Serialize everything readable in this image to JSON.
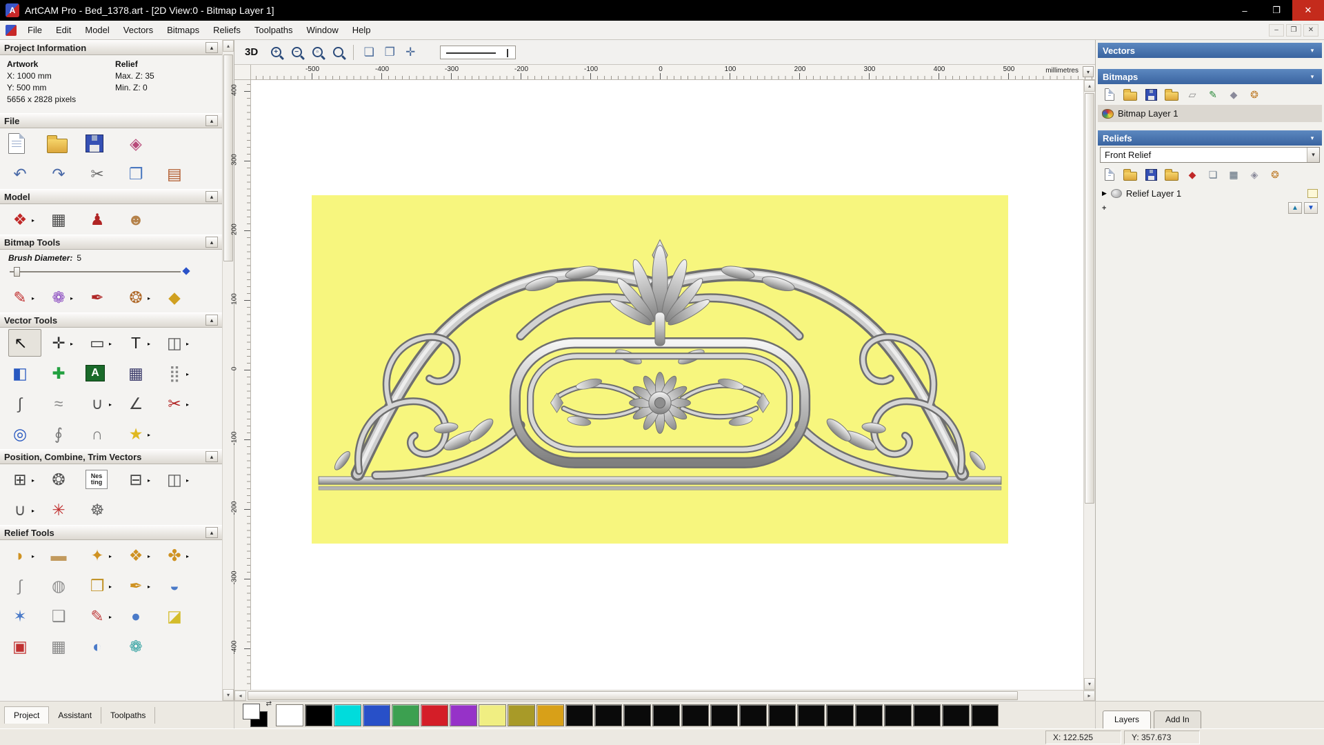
{
  "window": {
    "title": "ArtCAM Pro - Bed_1378.art - [2D View:0 - Bitmap Layer 1]"
  },
  "menu": {
    "items": [
      "File",
      "Edit",
      "Model",
      "Vectors",
      "Bitmaps",
      "Reliefs",
      "Toolpaths",
      "Window",
      "Help"
    ]
  },
  "left_panel": {
    "project_information": {
      "title": "Project Information",
      "artwork_label": "Artwork",
      "relief_label": "Relief",
      "x": "X: 1000 mm",
      "y": "Y: 500 mm",
      "pixels": "5656 x 2828 pixels",
      "max_z": "Max. Z: 35",
      "min_z": "Min. Z: 0"
    },
    "sections": {
      "file": "File",
      "model": "Model",
      "bitmap_tools": "Bitmap Tools",
      "vector_tools": "Vector Tools",
      "position_combine": "Position, Combine, Trim Vectors",
      "relief_tools": "Relief Tools"
    },
    "brush": {
      "label": "Brush Diameter:",
      "value": "5"
    },
    "tabs": [
      "Project",
      "Assistant",
      "Toolpaths"
    ],
    "icons": {
      "file_row1": [
        {
          "name": "new-model",
          "style": "ic-page"
        },
        {
          "name": "open-model",
          "style": "ic-folder"
        },
        {
          "name": "save-model",
          "style": "ic-disk"
        },
        {
          "name": "import-model",
          "glyph": "◈",
          "color": "#b84a7a"
        }
      ],
      "file_row2": [
        {
          "name": "undo",
          "glyph": "↶",
          "color": "#4a6aa8"
        },
        {
          "name": "redo",
          "glyph": "↷",
          "color": "#4a6aa8"
        },
        {
          "name": "cut",
          "glyph": "✂",
          "color": "#6a6a6a"
        },
        {
          "name": "copy",
          "glyph": "❐",
          "color": "#4a78c0"
        },
        {
          "name": "paste",
          "glyph": "▤",
          "color": "#b0582a"
        }
      ],
      "model_row": [
        {
          "name": "set-model-size",
          "glyph": "❖",
          "color": "#c02828",
          "flyout": true
        },
        {
          "name": "add-draft",
          "glyph": "▦",
          "color": "#4a4a4a"
        },
        {
          "name": "import-clipart",
          "glyph": "♟",
          "color": "#b02424"
        },
        {
          "name": "face-wizard",
          "glyph": "☻",
          "color": "#b5824a"
        }
      ],
      "bitmap_row": [
        {
          "name": "paint",
          "glyph": "✎",
          "color": "#c03030",
          "flyout": true
        },
        {
          "name": "paint-selective",
          "glyph": "❁",
          "color": "#8a4ac0",
          "flyout": true
        },
        {
          "name": "colour-picker",
          "glyph": "✒",
          "color": "#b02828"
        },
        {
          "name": "edit-colour-palette",
          "glyph": "❂",
          "color": "#b06a2a",
          "flyout": true
        },
        {
          "name": "flood-fill",
          "glyph": "◆",
          "color": "#d0a020"
        }
      ],
      "vector_row1": [
        {
          "name": "select-vectors",
          "glyph": "↖",
          "color": "#111111",
          "pressed": true
        },
        {
          "name": "transform-vectors",
          "glyph": "✛",
          "color": "#333333",
          "flyout": true
        },
        {
          "name": "create-rectangle",
          "glyph": "▭",
          "color": "#333333",
          "flyout": true
        },
        {
          "name": "create-text",
          "glyph": "T",
          "color": "#222222",
          "flyout": true
        },
        {
          "name": "mirror-vectors",
          "glyph": "◫",
          "color": "#555555",
          "flyout": true
        }
      ],
      "vector_row2": [
        {
          "name": "vector-fill",
          "glyph": "◧",
          "color": "#2858c0"
        },
        {
          "name": "node-editing",
          "glyph": "✚",
          "color": "#22a040"
        },
        {
          "name": "wrap-text",
          "glyph": "A",
          "style": "ic-box"
        },
        {
          "name": "paste-along-curve",
          "glyph": "▦",
          "color": "#3a3a6a"
        },
        {
          "name": "block-array-copy",
          "glyph": "⣿",
          "color": "#888888",
          "flyout": true
        }
      ],
      "vector_row3": [
        {
          "name": "fit-arcs-to-curve",
          "glyph": "∫",
          "color": "#555555"
        },
        {
          "name": "fit-curve-to-bitmap",
          "glyph": "≈",
          "color": "#888888"
        },
        {
          "name": "create-arc",
          "glyph": "∪",
          "color": "#555555",
          "flyout": true
        },
        {
          "name": "create-polyline",
          "glyph": "∠",
          "color": "#444444"
        },
        {
          "name": "trim-vectors",
          "glyph": "✂",
          "color": "#b02020",
          "flyout": true
        }
      ],
      "vector_row4": [
        {
          "name": "create-ring",
          "glyph": "◎",
          "color": "#2858c0"
        },
        {
          "name": "distort-vectors",
          "glyph": "∮",
          "color": "#777777"
        },
        {
          "name": "vector-doctor",
          "glyph": "∩",
          "color": "#777777"
        },
        {
          "name": "create-star",
          "glyph": "★",
          "color": "#e0b820",
          "flyout": true
        }
      ],
      "position_row1": [
        {
          "name": "align-vectors",
          "glyph": "⊞",
          "color": "#444444",
          "flyout": true
        },
        {
          "name": "circular-array-copy",
          "glyph": "❂",
          "color": "#555555"
        },
        {
          "name": "nesting",
          "glyph": "Nes\nting",
          "style": "ic-nesting"
        },
        {
          "name": "block-array",
          "glyph": "⊟",
          "color": "#444444",
          "flyout": true
        },
        {
          "name": "group-vectors",
          "glyph": "◫",
          "color": "#555555",
          "flyout": true
        }
      ],
      "position_row2": [
        {
          "name": "join-vectors",
          "glyph": "∪",
          "color": "#555555",
          "flyout": true
        },
        {
          "name": "fillet-vectors",
          "glyph": "✳",
          "color": "#c03030"
        },
        {
          "name": "create-spiral",
          "glyph": "☸",
          "color": "#666666"
        }
      ],
      "relief_row1": [
        {
          "name": "shape-editor",
          "glyph": "◗",
          "color": "#cf9222",
          "flyout": true
        },
        {
          "name": "smooth-relief",
          "glyph": "▬",
          "color": "#c29a5e"
        },
        {
          "name": "sculpting-tools",
          "glyph": "✦",
          "color": "#cf9222",
          "flyout": true
        },
        {
          "name": "dome-relief",
          "glyph": "❖",
          "color": "#cf9222",
          "flyout": true
        },
        {
          "name": "texture-relief",
          "glyph": "✤",
          "color": "#cf9222",
          "flyout": true
        }
      ],
      "relief_row2": [
        {
          "name": "two-rail-sweep",
          "glyph": "∫",
          "color": "#8e8e8e"
        },
        {
          "name": "weave-wizard",
          "glyph": "◍",
          "color": "#8e8e8e"
        },
        {
          "name": "extrude-relief",
          "glyph": "❒",
          "color": "#c2942a",
          "flyout": true
        },
        {
          "name": "spin-relief",
          "glyph": "✒",
          "color": "#cf9222",
          "flyout": true
        },
        {
          "name": "two-curve-shape",
          "glyph": "◒",
          "color": "#4a7ac8"
        }
      ],
      "relief_row3": [
        {
          "name": "interactive-sculpting",
          "glyph": "✶",
          "color": "#4a7ac8"
        },
        {
          "name": "offset-relief",
          "glyph": "❑",
          "color": "#8e8e8e"
        },
        {
          "name": "smudge-relief",
          "glyph": "✎",
          "color": "#c04040",
          "flyout": true
        },
        {
          "name": "texture-ball",
          "glyph": "●",
          "color": "#4a7ac8"
        },
        {
          "name": "relief-layer-stack",
          "glyph": "◪",
          "color": "#d4bc2a"
        }
      ],
      "relief_row4": [
        {
          "name": "relief-tool-a",
          "glyph": "▣",
          "color": "#c03030"
        },
        {
          "name": "relief-tool-b",
          "glyph": "▦",
          "color": "#888888"
        },
        {
          "name": "relief-tool-c",
          "glyph": "◐",
          "color": "#4a7ac8"
        },
        {
          "name": "relief-tool-d",
          "glyph": "❁",
          "color": "#30a0a0"
        }
      ]
    }
  },
  "canvas": {
    "toolbar": {
      "view_3d": "3D",
      "icons": [
        {
          "name": "zoom-in",
          "style": "ic-zoom",
          "glyph": "+"
        },
        {
          "name": "zoom-out",
          "style": "ic-zoom",
          "glyph": "−"
        },
        {
          "name": "zoom-window",
          "style": "ic-zoom",
          "glyph": "▫"
        },
        {
          "name": "zoom-extents",
          "style": "ic-zoom",
          "glyph": ""
        },
        {
          "name": "toolbar-separator",
          "style": "sep"
        },
        {
          "name": "zoom-to-objects",
          "glyph": "❏",
          "color": "#4a6a9a"
        },
        {
          "name": "zoom-previous-view",
          "glyph": "❐",
          "color": "#4a6a9a"
        },
        {
          "name": "pan-view",
          "glyph": "✛",
          "color": "#4a6a9a"
        }
      ]
    },
    "ruler_h": [
      "-500",
      "-400",
      "-300",
      "-200",
      "-100",
      "0",
      "100",
      "200",
      "300",
      "400",
      "500"
    ],
    "ruler_h_unit": "millimetres",
    "ruler_v": [
      "400",
      "300",
      "200",
      "100",
      "0",
      "-100",
      "-200",
      "-300",
      "-400"
    ]
  },
  "right_panel": {
    "vectors_title": "Vectors",
    "bitmaps_title": "Bitmaps",
    "bitmap_layer": "Bitmap Layer 1",
    "reliefs_title": "Reliefs",
    "relief_select": "Front Relief",
    "relief_layer": "Relief Layer 1",
    "plus_mark": "+",
    "tabs": [
      "Layers",
      "Add In"
    ],
    "icons": {
      "bitmaps": [
        {
          "name": "new-bitmap-layer",
          "style": "ic-page"
        },
        {
          "name": "open-bitmap-layer",
          "style": "ic-folder"
        },
        {
          "name": "save-bitmap-layer",
          "style": "ic-disk"
        },
        {
          "name": "import-bitmap-layer",
          "style": "ic-folder"
        },
        {
          "name": "greyscale-view",
          "glyph": "▱",
          "color": "#888888"
        },
        {
          "name": "edit-bitmap-layer",
          "glyph": "✎",
          "color": "#2a8a3a"
        },
        {
          "name": "delete-bitmap-layer",
          "glyph": "◆",
          "color": "#8a8a9a"
        },
        {
          "name": "bitmap-layer-options",
          "glyph": "❂",
          "color": "#c08030"
        }
      ],
      "reliefs": [
        {
          "name": "new-relief-layer",
          "style": "ic-page"
        },
        {
          "name": "open-relief-layer",
          "style": "ic-folder"
        },
        {
          "name": "save-relief-layer",
          "style": "ic-disk"
        },
        {
          "name": "import-relief-layer",
          "style": "ic-folder"
        },
        {
          "name": "relief-from-vector",
          "glyph": "◆",
          "color": "#c02828"
        },
        {
          "name": "relief-sheet",
          "glyph": "❏",
          "color": "#667788"
        },
        {
          "name": "calculate-relief",
          "glyph": "▦",
          "color": "#556677"
        },
        {
          "name": "delete-relief-layer",
          "glyph": "◈",
          "color": "#8a8a9a"
        },
        {
          "name": "relief-layer-options",
          "glyph": "❂",
          "color": "#c08030"
        }
      ]
    }
  },
  "palette": {
    "colors": [
      "#ffffff",
      "#000000",
      "#00dcdc",
      "#2850c8",
      "#3ca050",
      "#d41e28",
      "#9632c8",
      "#f0ee82",
      "#a89a28",
      "#d8a018",
      "#0a0a0a",
      "#0a0a0a",
      "#0a0a0a",
      "#0a0a0a",
      "#0a0a0a",
      "#0a0a0a",
      "#0a0a0a",
      "#0a0a0a",
      "#0a0a0a",
      "#0a0a0a",
      "#0a0a0a",
      "#0a0a0a",
      "#0a0a0a",
      "#0a0a0a",
      "#0a0a0a"
    ]
  },
  "status": {
    "x": "X: 122.525",
    "y": "Y: 357.673"
  },
  "ui_colors": {
    "panel_header_blue": "#4a74ae",
    "canvas_yellow": "#f7f67e",
    "title_bar": "#000000",
    "close_red": "#c42b1c"
  }
}
